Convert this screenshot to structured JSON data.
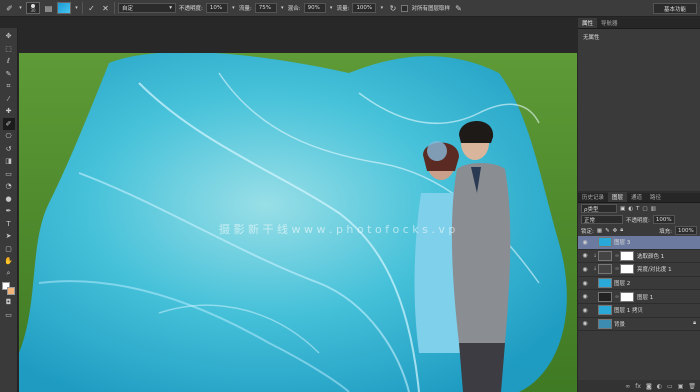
{
  "options_bar": {
    "brush_size": "30",
    "mode": "自定",
    "opacity_label": "不透明度:",
    "opacity_value": "10%",
    "flow_label": "流量:",
    "flow_value": "75%",
    "blend_label": "混合:",
    "blend_value": "90%",
    "strength_label": "流量:",
    "strength_value": "100%",
    "sample_all_label": "对所有图层取样",
    "workspace": "基本功能"
  },
  "tools": [
    {
      "name": "move-tool",
      "glyph": "✥"
    },
    {
      "name": "marquee-tool",
      "glyph": "⬚"
    },
    {
      "name": "lasso-tool",
      "glyph": "ℓ"
    },
    {
      "name": "quick-select-tool",
      "glyph": "✎"
    },
    {
      "name": "crop-tool",
      "glyph": "⌗"
    },
    {
      "name": "eyedropper-tool",
      "glyph": "⁄"
    },
    {
      "name": "healing-tool",
      "glyph": "✚"
    },
    {
      "name": "brush-tool",
      "glyph": "✐"
    },
    {
      "name": "stamp-tool",
      "glyph": "⎔"
    },
    {
      "name": "history-brush-tool",
      "glyph": "↺"
    },
    {
      "name": "eraser-tool",
      "glyph": "◨"
    },
    {
      "name": "gradient-tool",
      "glyph": "▭"
    },
    {
      "name": "blur-tool",
      "glyph": "◔"
    },
    {
      "name": "dodge-tool",
      "glyph": "●"
    },
    {
      "name": "pen-tool",
      "glyph": "✒"
    },
    {
      "name": "type-tool",
      "glyph": "T"
    },
    {
      "name": "path-select-tool",
      "glyph": "➤"
    },
    {
      "name": "shape-tool",
      "glyph": "▢"
    },
    {
      "name": "hand-tool",
      "glyph": "✋"
    },
    {
      "name": "zoom-tool",
      "glyph": "⌕"
    }
  ],
  "properties_panel": {
    "tabs": [
      "属性",
      "导航器"
    ],
    "content": "无属性"
  },
  "layers_panel": {
    "tabs": [
      "历史记录",
      "图层",
      "通道",
      "路径"
    ],
    "kind_label": "ρ类型",
    "blend_mode": "正常",
    "opacity_label": "不透明度:",
    "opacity_value": "100%",
    "lock_label": "锁定:",
    "fill_label": "填充:",
    "fill_value": "100%",
    "layers": [
      {
        "name": "图层 3",
        "selected": true,
        "thumb": "#2aa8d8",
        "mask": false
      },
      {
        "name": "选取颜色 1",
        "selected": false,
        "thumb": "#444",
        "mask": true,
        "adjust": true
      },
      {
        "name": "亮度/对比度 1",
        "selected": false,
        "thumb": "#444",
        "mask": true,
        "adjust": true
      },
      {
        "name": "图层 2",
        "selected": false,
        "thumb": "#2aa8d8",
        "mask": false
      },
      {
        "name": "图层 1",
        "selected": false,
        "thumb": "#222",
        "mask": true
      },
      {
        "name": "图层 1 拷贝",
        "selected": false,
        "thumb": "#2aa8d8",
        "mask": false
      },
      {
        "name": "背景",
        "selected": false,
        "thumb": "#3c8bb0",
        "mask": false,
        "locked": true
      }
    ]
  },
  "watermark": "摄 影 新 干 线   w w w . p h o t o f o c k s . v p",
  "colors": {
    "veil": "#38c3e6",
    "grass": "#4e8a2e",
    "accent": "#6b7a9e"
  }
}
